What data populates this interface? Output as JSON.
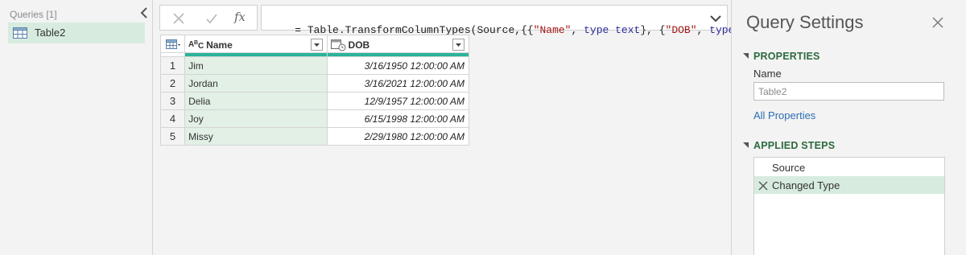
{
  "queries_pane": {
    "header": "Queries [1]",
    "items": [
      {
        "label": "Table2"
      }
    ]
  },
  "formula_bar": {
    "text_parts": [
      {
        "t": "= Table.TransformColumnTypes(Source,{{",
        "c": ""
      },
      {
        "t": "\"Name\"",
        "c": "str"
      },
      {
        "t": ", ",
        "c": ""
      },
      {
        "t": "type text",
        "c": "kw"
      },
      {
        "t": "}, {",
        "c": ""
      },
      {
        "t": "\"DOB\"",
        "c": "str"
      },
      {
        "t": ", ",
        "c": ""
      },
      {
        "t": "type",
        "c": "kw"
      }
    ]
  },
  "grid": {
    "columns": [
      {
        "label": "Name",
        "type_icon": "abc-text-icon"
      },
      {
        "label": "DOB",
        "type_icon": "datetime-icon"
      }
    ],
    "rows": [
      {
        "num": "1",
        "name": "Jim",
        "dob": "3/16/1950 12:00:00 AM"
      },
      {
        "num": "2",
        "name": "Jordan",
        "dob": "3/16/2021 12:00:00 AM"
      },
      {
        "num": "3",
        "name": "Delia",
        "dob": "12/9/1957 12:00:00 AM"
      },
      {
        "num": "4",
        "name": "Joy",
        "dob": "6/15/1998 12:00:00 AM"
      },
      {
        "num": "5",
        "name": "Missy",
        "dob": "2/29/1980 12:00:00 AM"
      }
    ]
  },
  "settings": {
    "title": "Query Settings",
    "properties_header": "PROPERTIES",
    "name_label": "Name",
    "name_value": "Table2",
    "all_properties": "All Properties",
    "applied_steps_header": "APPLIED STEPS",
    "steps": [
      {
        "label": "Source",
        "active": false
      },
      {
        "label": "Changed Type",
        "active": true
      }
    ]
  },
  "colors": {
    "accent_green": "#2ab39b",
    "selection_green": "#d7ecdf",
    "section_header": "#2c6a3f",
    "link": "#2e6db4"
  }
}
